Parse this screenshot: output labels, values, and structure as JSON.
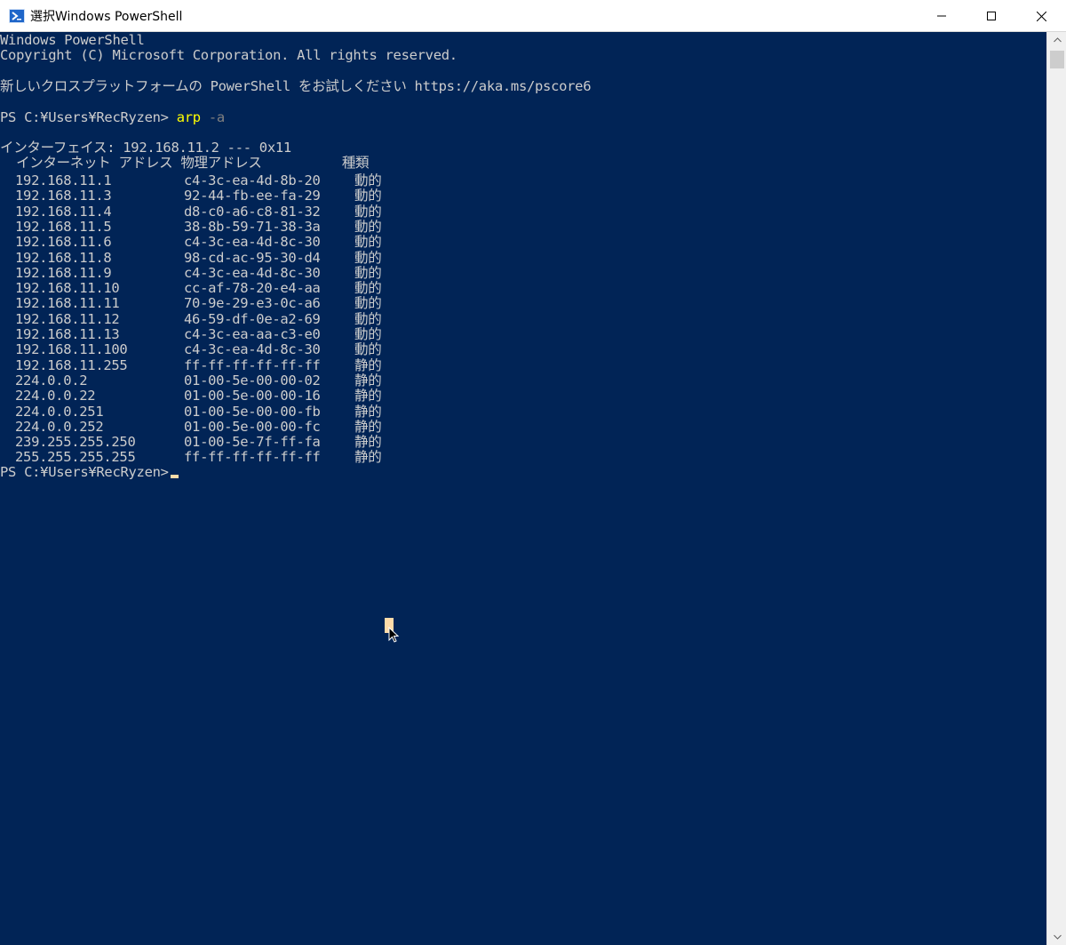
{
  "window": {
    "title": "選択Windows PowerShell",
    "icon": "powershell-icon"
  },
  "controls": {
    "minimize": "minimize-icon",
    "maximize": "maximize-icon",
    "close": "close-icon"
  },
  "console": {
    "header_line1": "Windows PowerShell",
    "header_line2": "Copyright (C) Microsoft Corporation. All rights reserved.",
    "header_line3": "新しいクロスプラットフォームの PowerShell をお試しください https://aka.ms/pscore6",
    "prompt1": "PS C:¥Users¥RecRyzen> ",
    "command": "arp",
    "command_arg": " -a",
    "interface_line": "インターフェイス: 192.168.11.2 --- 0x11",
    "table_header": "  インターネット アドレス 物理アドレス          種類",
    "rows": [
      {
        "ip": "192.168.11.1",
        "mac": "c4-3c-ea-4d-8b-20",
        "type": "動的"
      },
      {
        "ip": "192.168.11.3",
        "mac": "92-44-fb-ee-fa-29",
        "type": "動的"
      },
      {
        "ip": "192.168.11.4",
        "mac": "d8-c0-a6-c8-81-32",
        "type": "動的"
      },
      {
        "ip": "192.168.11.5",
        "mac": "38-8b-59-71-38-3a",
        "type": "動的"
      },
      {
        "ip": "192.168.11.6",
        "mac": "c4-3c-ea-4d-8c-30",
        "type": "動的"
      },
      {
        "ip": "192.168.11.8",
        "mac": "98-cd-ac-95-30-d4",
        "type": "動的"
      },
      {
        "ip": "192.168.11.9",
        "mac": "c4-3c-ea-4d-8c-30",
        "type": "動的"
      },
      {
        "ip": "192.168.11.10",
        "mac": "cc-af-78-20-e4-aa",
        "type": "動的"
      },
      {
        "ip": "192.168.11.11",
        "mac": "70-9e-29-e3-0c-a6",
        "type": "動的"
      },
      {
        "ip": "192.168.11.12",
        "mac": "46-59-df-0e-a2-69",
        "type": "動的"
      },
      {
        "ip": "192.168.11.13",
        "mac": "c4-3c-ea-aa-c3-e0",
        "type": "動的"
      },
      {
        "ip": "192.168.11.100",
        "mac": "c4-3c-ea-4d-8c-30",
        "type": "動的"
      },
      {
        "ip": "192.168.11.255",
        "mac": "ff-ff-ff-ff-ff-ff",
        "type": "静的"
      },
      {
        "ip": "224.0.0.2",
        "mac": "01-00-5e-00-00-02",
        "type": "静的"
      },
      {
        "ip": "224.0.0.22",
        "mac": "01-00-5e-00-00-16",
        "type": "静的"
      },
      {
        "ip": "224.0.0.251",
        "mac": "01-00-5e-00-00-fb",
        "type": "静的"
      },
      {
        "ip": "224.0.0.252",
        "mac": "01-00-5e-00-00-fc",
        "type": "静的"
      },
      {
        "ip": "239.255.255.250",
        "mac": "01-00-5e-7f-ff-fa",
        "type": "静的"
      },
      {
        "ip": "255.255.255.255",
        "mac": "ff-ff-ff-ff-ff-ff",
        "type": "静的"
      }
    ],
    "prompt2": "PS C:¥Users¥RecRyzen> "
  },
  "colors": {
    "background": "#012456",
    "text": "#cccccc",
    "command": "#ffff00",
    "argument": "#808080",
    "cursor": "#fedba9"
  }
}
